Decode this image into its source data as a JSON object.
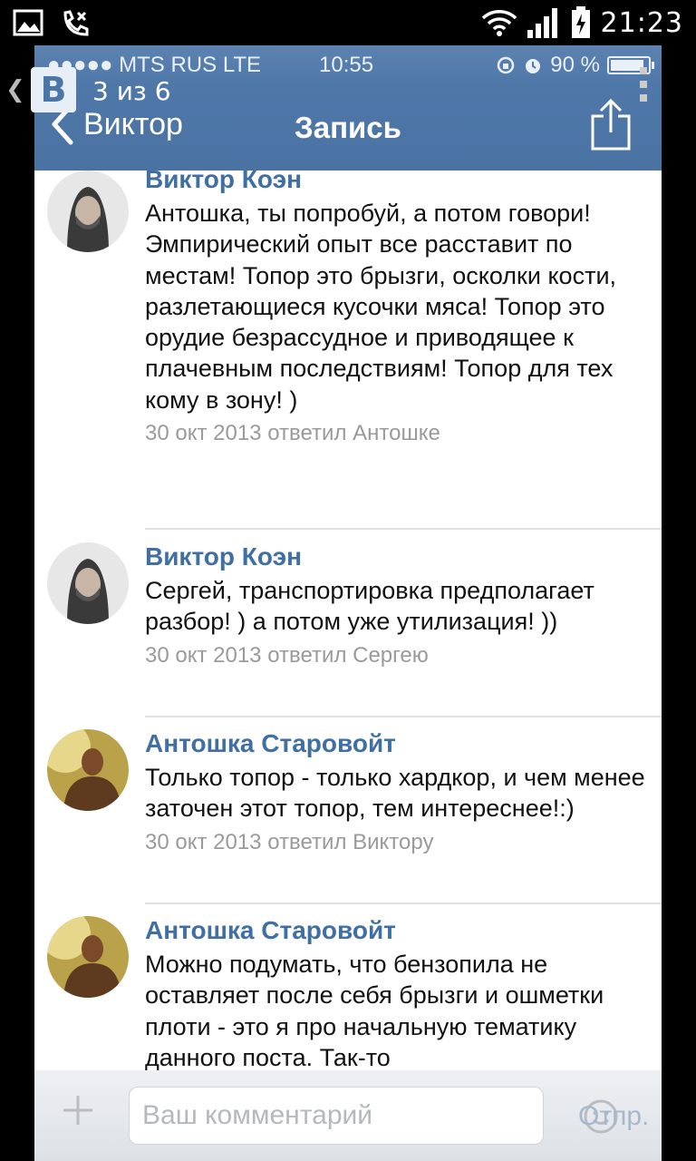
{
  "android": {
    "time": "21:23"
  },
  "gallery": {
    "logo": "В",
    "counter": "3 из 6"
  },
  "ios_status": {
    "carrier": "●●●●● MTS RUS  LTE",
    "time": "10:55",
    "battery": "90 %"
  },
  "nav": {
    "back_label": "Виктор",
    "title": "Запись"
  },
  "comments": [
    {
      "author": "Виктор Коэн",
      "text": "Антошка, ты попробуй, а потом говори! Эмпирический опыт все расставит по местам! Топор это брызги, осколки кости, разлетающиеся кусочки мяса! Топор это орудие безрассудное и приводящее к плачевным последствиям! Топор для тех кому в зону! )",
      "meta": "30 окт 2013 ответил Антошке"
    },
    {
      "author": "Виктор Коэн",
      "text": "Сергей, транспортировка предполагает разбор! ) а потом уже утилизация! ))",
      "meta": "30 окт 2013 ответил Сергею"
    },
    {
      "author": "Антошка Старовойт",
      "text": "Только топор - только хардкор, и чем менее заточен этот топор, тем интереснее!:)",
      "meta": "30 окт 2013 ответил Виктору"
    },
    {
      "author": "Антошка Старовойт",
      "text": "Можно подумать, что бензопила не оставляет после себя брызги и ошметки плоти - это я про начальную тематику данного поста. Так-то",
      "meta": ""
    }
  ],
  "composer": {
    "placeholder": "Ваш комментарий",
    "send_label": "Отпр."
  },
  "colors": {
    "accent": "#4f78a9",
    "author": "#3f6fa3",
    "meta": "#9a9a9a"
  }
}
